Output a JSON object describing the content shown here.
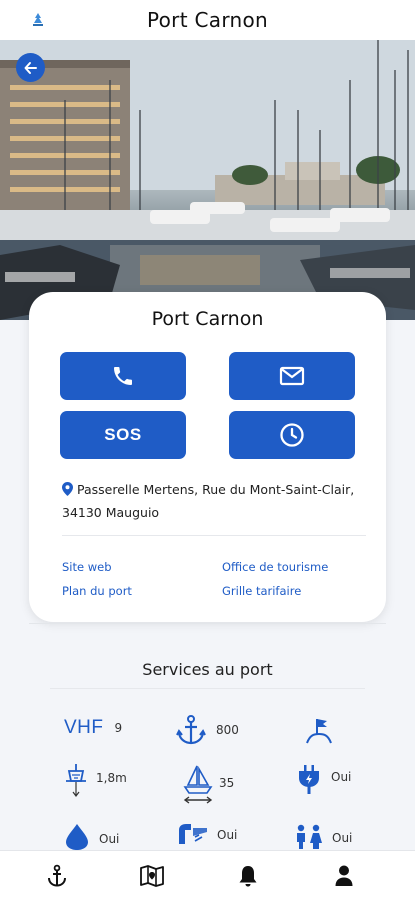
{
  "header": {
    "title": "Port Carnon",
    "logo_icon": "port-logo-icon"
  },
  "colors": {
    "primary": "#1f5cc6",
    "background": "#f3f5f9"
  },
  "card": {
    "title": "Port Carnon",
    "buttons": {
      "phone_icon": "phone-icon",
      "email_icon": "mail-icon",
      "sos_label": "SOS",
      "hours_icon": "clock-icon"
    },
    "address_line1": "Passerelle Mertens, Rue du Mont-Saint-Clair,",
    "address_line2": "34130 Mauguio",
    "links": {
      "website": "Site web",
      "tourism": "Office de tourisme",
      "plan": "Plan du port",
      "rates": "Grille tarifaire"
    }
  },
  "services": {
    "title": "Services au port",
    "items": [
      {
        "icon": "vhf-label",
        "label": "VHF",
        "value": "9"
      },
      {
        "icon": "anchor-icon",
        "value": "800"
      },
      {
        "icon": "harbor-flag-icon",
        "value": ""
      },
      {
        "icon": "draft-depth-icon",
        "value": "1,8m"
      },
      {
        "icon": "boat-length-icon",
        "value": "35"
      },
      {
        "icon": "electricity-plug-icon",
        "value": "Oui"
      },
      {
        "icon": "water-drop-icon",
        "value": "Oui"
      },
      {
        "icon": "fuel-icon",
        "value": "Oui"
      },
      {
        "icon": "toilets-icon",
        "value": "Oui"
      }
    ]
  },
  "bottom_nav": [
    "anchor-icon",
    "map-icon",
    "bell-icon",
    "user-icon"
  ]
}
